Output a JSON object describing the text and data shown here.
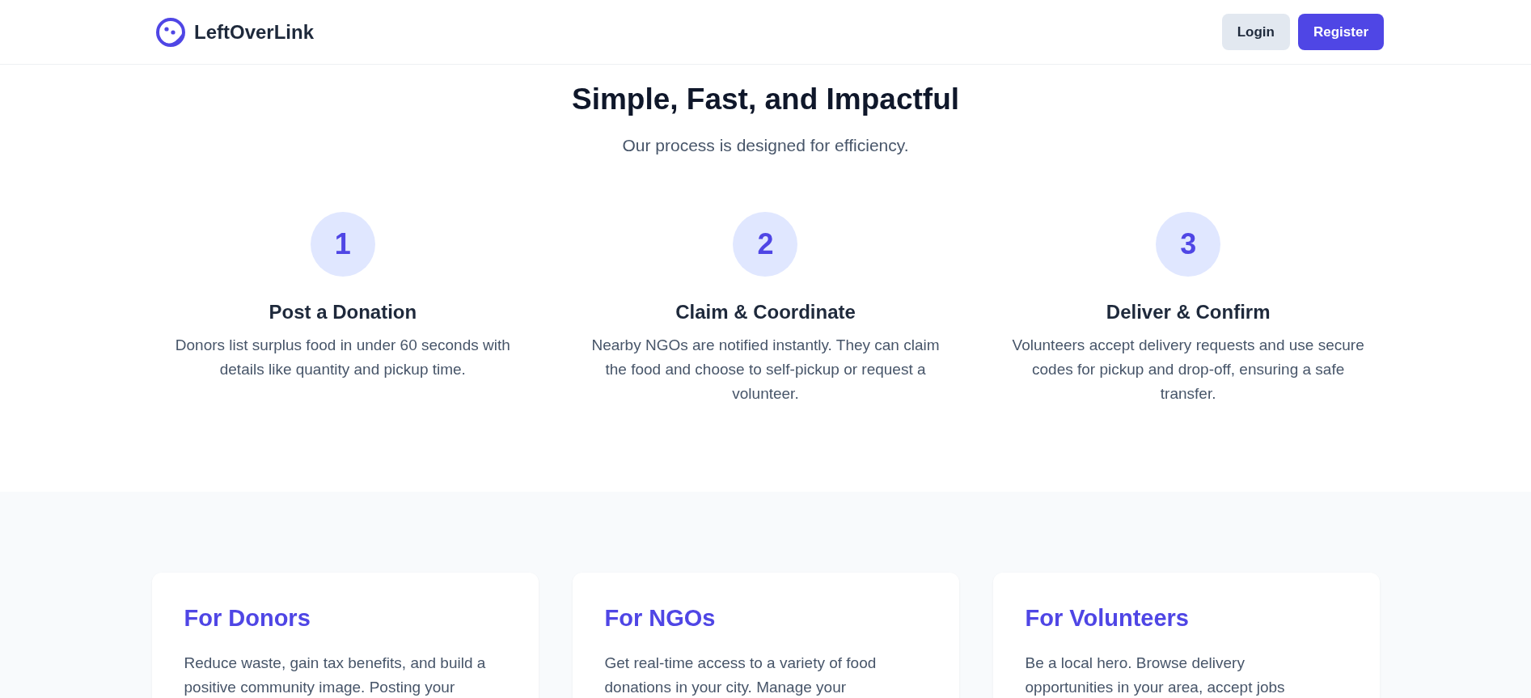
{
  "header": {
    "brand": "LeftOverLink",
    "buttons": [
      {
        "label": "Login",
        "kind": "secondary"
      },
      {
        "label": "Register",
        "kind": "primary"
      }
    ]
  },
  "process": {
    "title": "Simple, Fast, and Impactful",
    "subtitle": "Our process is designed for efficiency.",
    "steps": [
      {
        "number": "1",
        "title": "Post a Donation",
        "text": "Donors list surplus food in under 60 seconds with details like quantity and pickup time."
      },
      {
        "number": "2",
        "title": "Claim & Coordinate",
        "text": "Nearby NGOs are notified instantly. They can claim the food and choose to self-pickup or request a volunteer."
      },
      {
        "number": "3",
        "title": "Deliver & Confirm",
        "text": "Volunteers accept delivery requests and use secure codes for pickup and drop-off, ensuring a safe transfer."
      }
    ]
  },
  "audiences": [
    {
      "title": "For Donors",
      "text": "Reduce waste, gain tax benefits, and build a positive community image. Posting your"
    },
    {
      "title": "For NGOs",
      "text": "Get real-time access to a variety of food donations in your city. Manage your"
    },
    {
      "title": "For Volunteers",
      "text": "Be a local hero. Browse delivery opportunities in your area, accept jobs"
    }
  ]
}
